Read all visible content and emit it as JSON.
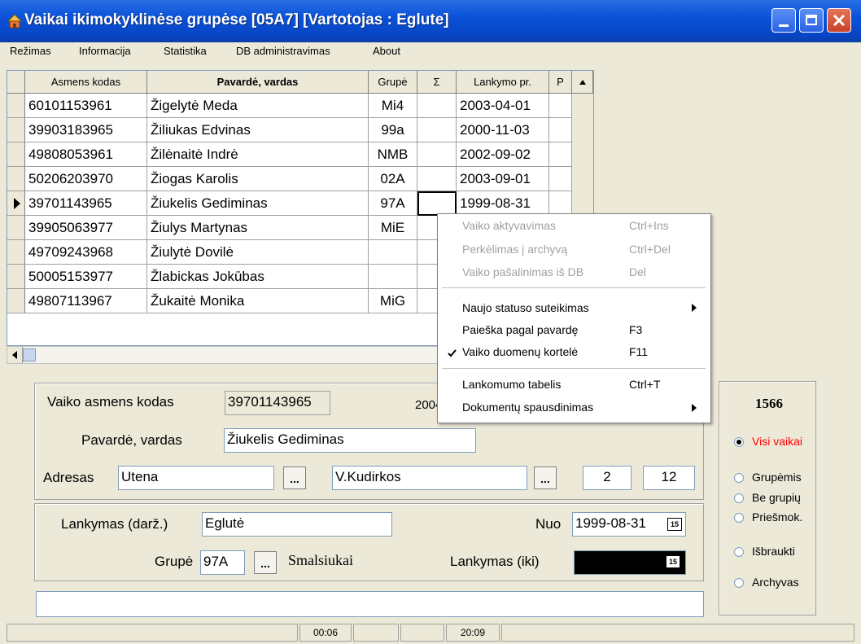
{
  "window": {
    "title": "Vaikai ikimokyklinėse grupėse [05A7] [Vartotojas : Eglute]"
  },
  "menu": [
    "Režimas",
    "Informacija",
    "Statistika",
    "DB administravimas",
    "About"
  ],
  "grid": {
    "headers": [
      "Asmens kodas",
      "Pavardė, vardas",
      "Grupė",
      "Σ",
      "Lankymo pr.",
      "P"
    ],
    "rows": [
      [
        "60101153961",
        "Žigelytė Meda",
        "Mi4",
        "",
        "2003-04-01"
      ],
      [
        "39903183965",
        "Žiliukas Edvinas",
        "99a",
        "",
        "2000-11-03"
      ],
      [
        "49808053961",
        "Žilėnaitė Indrė",
        "NMB",
        "",
        "2002-09-02"
      ],
      [
        "50206203970",
        "Žiogas Karolis",
        "02A",
        "",
        "2003-09-01"
      ],
      [
        "39701143965",
        "Žiukelis Gediminas",
        "97A",
        "",
        "1999-08-31"
      ],
      [
        "39905063977",
        "Žiulys Martynas",
        "MiE",
        "",
        ""
      ],
      [
        "49709243968",
        "Žiulytė Dovilė",
        "",
        "",
        ""
      ],
      [
        "50005153977",
        "Žlabickas Jokūbas",
        "",
        "",
        ""
      ],
      [
        "49807113967",
        "Žukaitė Monika",
        "MiG",
        "",
        ""
      ]
    ]
  },
  "form": {
    "asmens_kodas_label": "Vaiko asmens kodas",
    "asmens_kodas_value": "39701143965",
    "partial_date": "2004",
    "pavarde_label": "Pavardė, vardas",
    "pavarde_value": "Žiukelis Gediminas",
    "adresas_label": "Adresas",
    "city": "Utena",
    "street": "V.Kudirkos",
    "house": "2",
    "apt": "12",
    "dots": "...",
    "lankymas_label": "Lankymas (darž.)",
    "lankymas_value": "Eglutė",
    "nuo_label": "Nuo",
    "nuo_value": "1999-08-31",
    "grupe_label": "Grupė",
    "grupe_value": "97A",
    "grupe_name": "Smalsiukai",
    "iki_label": "Lankymas (iki)",
    "iki_value": "",
    "cal_icon": "15"
  },
  "filter": {
    "count": "1566",
    "options": [
      "Visi vaikai",
      "Grupėmis",
      "Be grupių",
      "Priešmok.",
      "Išbraukti",
      "Archyvas"
    ],
    "selected": "Visi vaikai",
    "selected_color": "#ff0000"
  },
  "context_menu": {
    "items": [
      {
        "label": "Vaiko aktyvavimas",
        "shortcut": "Ctrl+Ins"
      },
      {
        "label": "Perkėlimas į archyvą",
        "shortcut": "Ctrl+Del"
      },
      {
        "label": "Vaiko pašalinimas iš DB",
        "shortcut": "Del"
      },
      {
        "label": "Naujo statuso suteikimas",
        "shortcut": ""
      },
      {
        "label": "Paieška pagal pavardę",
        "shortcut": "F3"
      },
      {
        "label": "Vaiko duomenų kortelė",
        "shortcut": "F11"
      },
      {
        "label": "Lankomumo tabelis",
        "shortcut": "Ctrl+T"
      },
      {
        "label": "Dokumentų spausdinimas",
        "shortcut": ""
      }
    ]
  },
  "status": {
    "time1": "00:06",
    "time2": "20:09"
  },
  "colors": {
    "titlebar": "#0a52d9",
    "selected_option": "#ff0000"
  }
}
